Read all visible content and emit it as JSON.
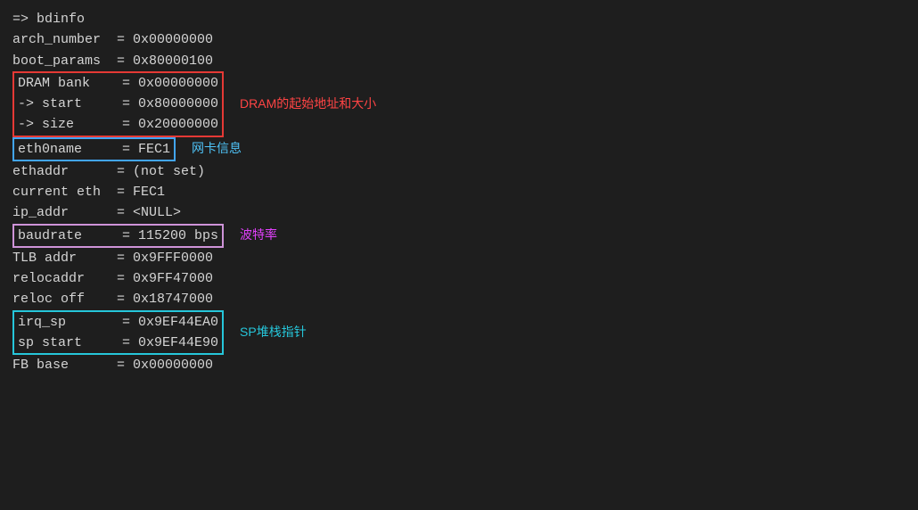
{
  "terminal": {
    "prompt_line": "=> bdinfo",
    "lines": [
      {
        "text": "arch_number  = 0x00000000",
        "border": null,
        "annotation": null,
        "ann_color": null
      },
      {
        "text": "boot_params  = 0x80000100",
        "border": null,
        "annotation": null,
        "ann_color": null
      }
    ],
    "dram_group": {
      "lines": [
        "DRAM bank    = 0x00000000",
        "-> start     = 0x80000000",
        "-> size      = 0x20000000"
      ],
      "border": "red",
      "annotation": "DRAM的起始地址和大小",
      "ann_color": "ann-red"
    },
    "eth0_group": {
      "lines": [
        "eth0name     = FEC1"
      ],
      "border": "blue",
      "annotation": "网卡信息",
      "ann_color": "ann-blue"
    },
    "after_eth": [
      "ethaddr      = (not set)",
      "current eth  = FEC1",
      "ip_addr      = <NULL>"
    ],
    "baud_group": {
      "lines": [
        "baudrate     = 115200 bps"
      ],
      "border": "magenta",
      "annotation": "波特率",
      "ann_color": "ann-magenta"
    },
    "after_baud": [
      "TLB addr     = 0x9FFF0000",
      "relocaddr    = 0x9FF47000",
      "reloc off    = 0x18747000"
    ],
    "irq_group": {
      "lines": [
        "irq_sp       = 0x9EF44EA0",
        "sp start     = 0x9EF44E90"
      ],
      "border": "teal",
      "annotation": "SP堆栈指针",
      "ann_color": "ann-teal"
    },
    "after_irq": [
      "FB base      = 0x00000000"
    ]
  }
}
